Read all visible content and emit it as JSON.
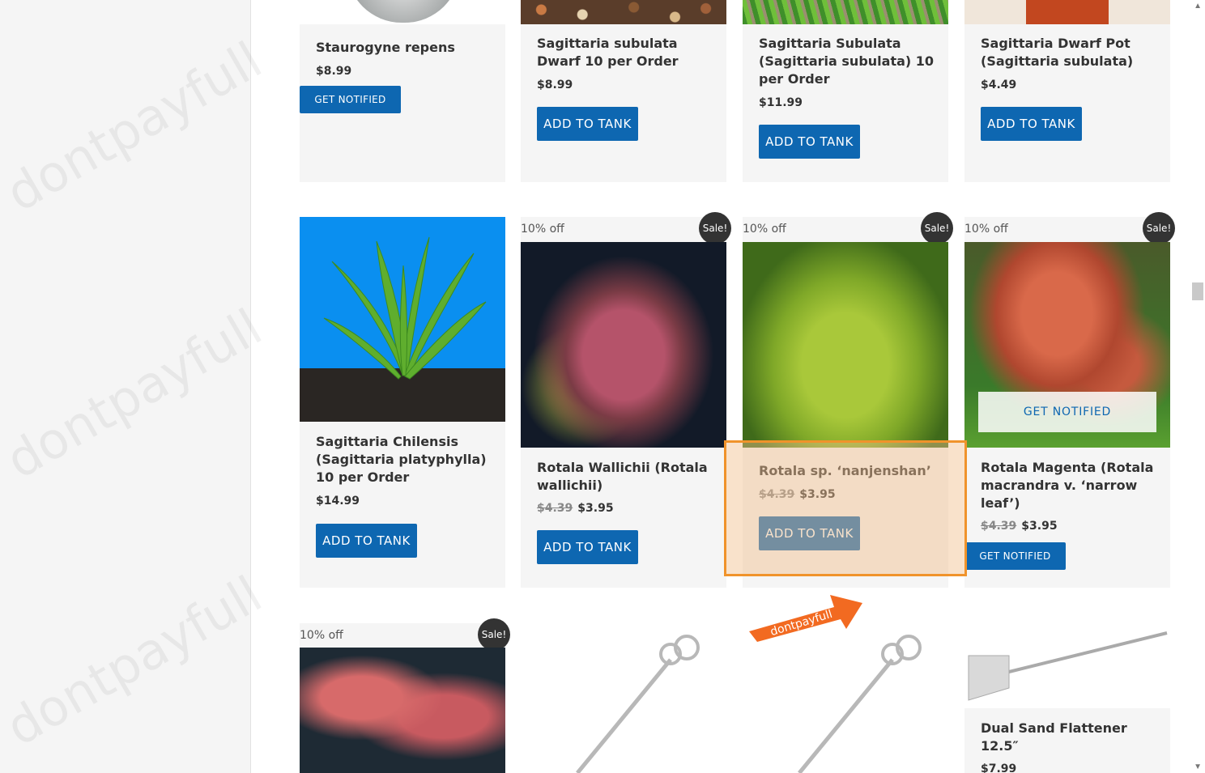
{
  "products": {
    "row1": [
      {
        "title": "Staurogyne repens",
        "price": "$8.99",
        "button": "GET NOTIFIED"
      },
      {
        "title": "Sagittaria subulata Dwarf 10 per Order",
        "price": "$8.99",
        "button": "ADD TO TANK"
      },
      {
        "title": "Sagittaria Subulata (Sagittaria subulata) 10 per Order",
        "price": "$11.99",
        "button": "ADD TO TANK"
      },
      {
        "title": "Sagittaria Dwarf Pot (Sagittaria subulata)",
        "price": "$4.49",
        "button": "ADD TO TANK"
      }
    ],
    "row2": [
      {
        "title": "Sagittaria Chilensis (Sagittaria platyphylla) 10 per Order",
        "price": "$14.99",
        "button": "ADD TO TANK"
      },
      {
        "discount": "10% off",
        "sale": "Sale!",
        "title": "Rotala Wallichii (Rotala wallichii)",
        "old_price": "$4.39",
        "price": "$3.95",
        "button": "ADD TO TANK"
      },
      {
        "discount": "10% off",
        "sale": "Sale!",
        "title": "Rotala sp. ‘nanjenshan’",
        "old_price": "$4.39",
        "price": "$3.95",
        "button": "ADD TO TANK"
      },
      {
        "discount": "10% off",
        "sale": "Sale!",
        "title": "Rotala Magenta (Rotala macrandra v. ‘narrow leaf’)",
        "old_price": "$4.39",
        "price": "$3.95",
        "button": "GET NOTIFIED",
        "overlay": "GET NOTIFIED"
      }
    ],
    "row3": [
      {
        "discount": "10% off",
        "sale": "Sale!"
      },
      {},
      {},
      {
        "title": "Dual Sand Flattener 12.5″",
        "price": "$7.99"
      }
    ]
  },
  "watermark": "dontpayfull",
  "arrow_badge": "dontpayfull",
  "colors": {
    "button": "#0e67b1",
    "highlight_border": "#f0932b",
    "sale_badge": "#333333"
  }
}
